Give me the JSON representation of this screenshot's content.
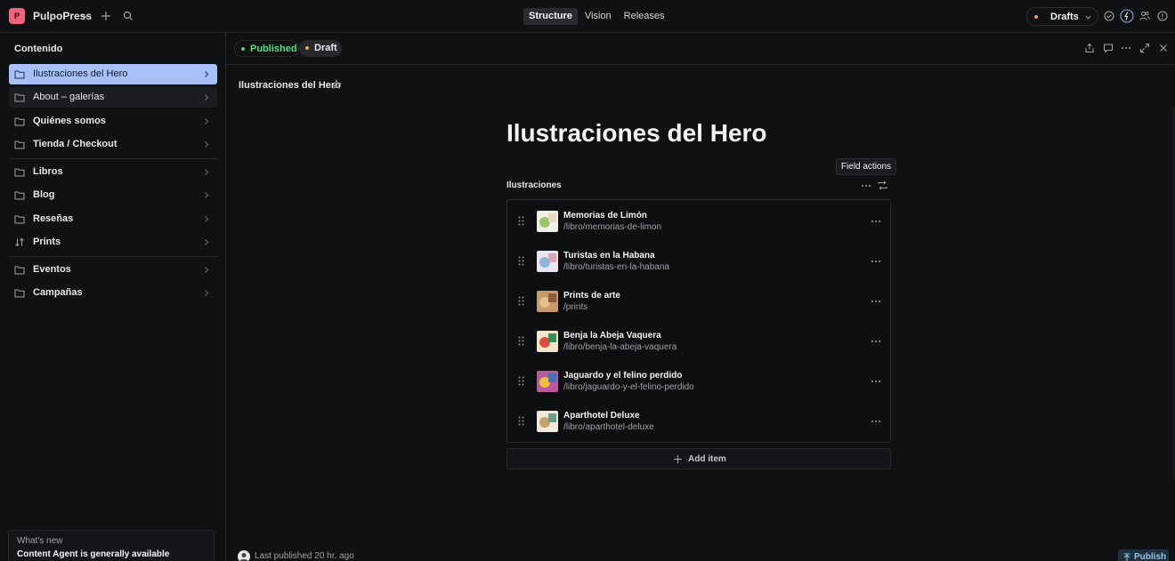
{
  "app": {
    "workspace": "PulpoPress",
    "logo_letter": "P",
    "accent": "#f0637b"
  },
  "topbar": {
    "tabs": [
      {
        "label": "Structure",
        "active": true
      },
      {
        "label": "Vision",
        "active": false
      },
      {
        "label": "Releases",
        "active": false
      }
    ],
    "perspective": "Drafts"
  },
  "sidebar": {
    "heading": "Contenido",
    "items": [
      {
        "label": "Ilustraciones del Hero",
        "icon": "folder-icon",
        "state": "selected"
      },
      {
        "label": "About – galerías",
        "icon": "folder-icon",
        "state": "hover"
      },
      {
        "label": "Quiénes somos",
        "icon": "folder-icon"
      },
      {
        "label": "Tienda / Checkout",
        "icon": "folder-icon"
      },
      {
        "label": "Libros",
        "icon": "folder-icon"
      },
      {
        "label": "Blog",
        "icon": "folder-icon"
      },
      {
        "label": "Reseñas",
        "icon": "folder-icon"
      },
      {
        "label": "Prints",
        "icon": "sort-icon"
      },
      {
        "label": "Eventos",
        "icon": "folder-icon"
      },
      {
        "label": "Campañas",
        "icon": "folder-icon"
      }
    ],
    "whats_new": {
      "title": "What's new",
      "text": "Content Agent is generally available"
    }
  },
  "document": {
    "status_published": "Published",
    "status_draft": "Draft",
    "breadcrumb": "Ilustraciones del Hero",
    "title": "Ilustraciones del Hero",
    "tooltip": "Field actions",
    "field_label": "Ilustraciones",
    "items": [
      {
        "title": "Memorias de Limón",
        "path": "/libro/memorias-de-limon",
        "thumb": [
          "#f2efe8",
          "#9bc46a",
          "#e8d9c2"
        ]
      },
      {
        "title": "Turistas en la Habana",
        "path": "/libro/turistas-en-la-habana",
        "thumb": [
          "#e9e6f2",
          "#8db6d8",
          "#d9a7b9"
        ]
      },
      {
        "title": "Prints de arte",
        "path": "/prints",
        "thumb": [
          "#c99a6a",
          "#e6c08c",
          "#8a5c3a"
        ]
      },
      {
        "title": "Benja la Abeja Vaquera",
        "path": "/libro/benja-la-abeja-vaquera",
        "thumb": [
          "#f3e6c9",
          "#e34b3a",
          "#3a8c5a"
        ]
      },
      {
        "title": "Jaguardo y el felino perdido",
        "path": "/libro/jaguardo-y-el-felino-perdido",
        "thumb": [
          "#b85a9c",
          "#f0c23c",
          "#4a6fb5"
        ]
      },
      {
        "title": "Aparthotel Deluxe",
        "path": "/libro/aparthotel-deluxe",
        "thumb": [
          "#efe9df",
          "#c8a46a",
          "#6a9c8a"
        ]
      }
    ],
    "add_item": "Add item"
  },
  "footer": {
    "last_published": "Last published 20 hr. ago",
    "publish": "Publish"
  }
}
